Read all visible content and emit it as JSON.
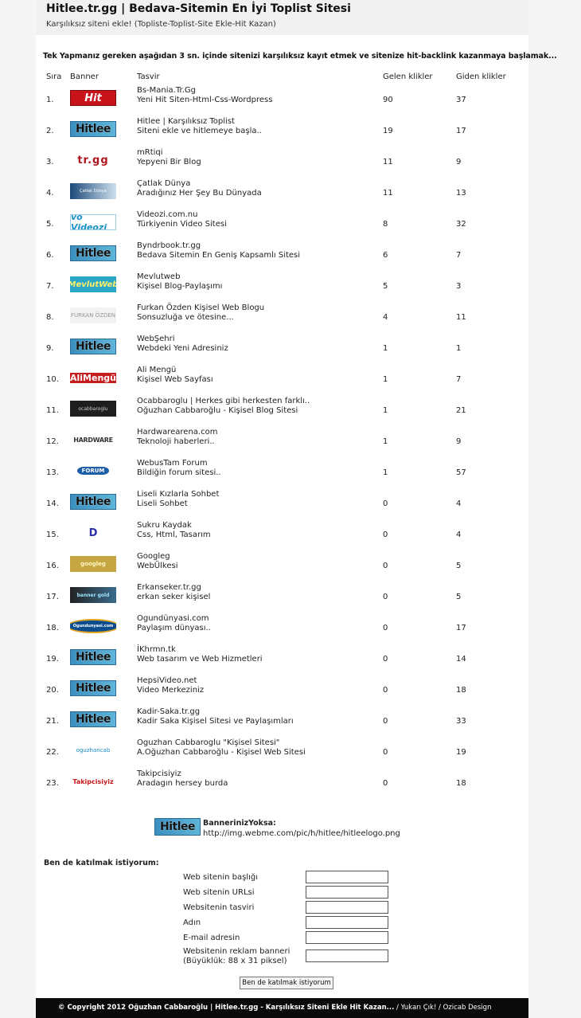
{
  "header": {
    "title": "Hitlee.tr.gg | Bedava-Sitemin En İyi Toplist Sitesi",
    "subtitle": "Karşılıksız siteni ekle! (Topliste-Toplist-Site Ekle-Hit Kazan)"
  },
  "intro": "Tek Yapmanız gereken aşağıdan 3 sn. içinde sitenizi karşılıksız kayıt etmek ve sitenize hit-backlink kazanmaya başlamak...",
  "table": {
    "columns": {
      "rank": "Sıra",
      "banner": "Banner",
      "desc": "Tasvir",
      "in": "Gelen klikler",
      "out": "Giden klikler"
    },
    "rows": [
      {
        "rank": "1.",
        "banner_text": "Hit",
        "banner_style": "b-hit",
        "title": "Bs-Mania.Tr.Gg",
        "desc": "Yeni Hit Siten-Html-Css-Wordpress",
        "in": "90",
        "out": "37"
      },
      {
        "rank": "2.",
        "banner_text": "Hitlee",
        "banner_style": "b-hitlee",
        "title": "Hitlee | Karşılıksız Toplist",
        "desc": "Siteni ekle ve hitlemeye başla..",
        "in": "19",
        "out": "17"
      },
      {
        "rank": "3.",
        "banner_text": "tr.gg",
        "banner_style": "b-trgg",
        "title": "mRtiqi",
        "desc": "Yepyeni Bir Blog",
        "in": "11",
        "out": "9"
      },
      {
        "rank": "4.",
        "banner_text": "Çatlak Dünya",
        "banner_style": "b-catlak",
        "title": "Çatlak Dünya",
        "desc": "Aradığınız Her Şey Bu Dünyada",
        "in": "11",
        "out": "13"
      },
      {
        "rank": "5.",
        "banner_text": "vo Videozi",
        "banner_style": "b-videozi",
        "title": "Videozi.com.nu",
        "desc": "Türkiyenin Video Sitesi",
        "in": "8",
        "out": "32"
      },
      {
        "rank": "6.",
        "banner_text": "Hitlee",
        "banner_style": "b-hitlee",
        "title": "Byndrbook.tr.gg",
        "desc": "Bedava Sitemin En Geniş Kapsamlı Sitesi",
        "in": "6",
        "out": "7"
      },
      {
        "rank": "7.",
        "banner_text": "MevlutWeb",
        "banner_style": "b-mevlut",
        "title": "Mevlutweb",
        "desc": "Kişisel Blog-Paylaşımı",
        "in": "5",
        "out": "3"
      },
      {
        "rank": "8.",
        "banner_text": "FURKAN ÖZDEN",
        "banner_style": "b-furkan",
        "title": "Furkan Özden Kişisel Web Blogu",
        "desc": "Sonsuzluğa ve ötesine...",
        "in": "4",
        "out": "11"
      },
      {
        "rank": "9.",
        "banner_text": "Hitlee",
        "banner_style": "b-hitlee",
        "title": "WebŞehri",
        "desc": "Webdeki Yeni Adresiniz",
        "in": "1",
        "out": "1"
      },
      {
        "rank": "10.",
        "banner_text": "AliMengü",
        "banner_style": "b-ali",
        "title": "Ali Mengü",
        "desc": "Kişisel Web Sayfası",
        "in": "1",
        "out": "7"
      },
      {
        "rank": "11.",
        "banner_text": "ocabbaroglu",
        "banner_style": "b-ocab",
        "title": "Ocabbaroglu | Herkes gibi herkesten farklı..",
        "desc": "Oğuzhan Cabbaroğlu - Kişisel Blog Sitesi",
        "in": "1",
        "out": "21"
      },
      {
        "rank": "12.",
        "banner_text": "HARDWARE",
        "banner_style": "b-hard",
        "title": "Hardwarearena.com",
        "desc": "Teknoloji haberleri..",
        "in": "1",
        "out": "9"
      },
      {
        "rank": "13.",
        "banner_text": "FORUM",
        "banner_style": "b-forum",
        "title": "WebusTam Forum",
        "desc": "Bildiğin forum sitesi..",
        "in": "1",
        "out": "57"
      },
      {
        "rank": "14.",
        "banner_text": "Hitlee",
        "banner_style": "b-hitlee",
        "title": "Liseli Kızlarla Sohbet",
        "desc": "Liseli Sohbet",
        "in": "0",
        "out": "4"
      },
      {
        "rank": "15.",
        "banner_text": "D",
        "banner_style": "b-sukru",
        "title": "Sukru Kaydak",
        "desc": "Css, Html, Tasarım",
        "in": "0",
        "out": "4"
      },
      {
        "rank": "16.",
        "banner_text": "googleg",
        "banner_style": "b-googleg",
        "title": "Googleg",
        "desc": "WebÜlkesi",
        "in": "0",
        "out": "5"
      },
      {
        "rank": "17.",
        "banner_text": "banner gold",
        "banner_style": "b-erkan",
        "title": "Erkanseker.tr.gg",
        "desc": "erkan seker kişisel",
        "in": "0",
        "out": "5"
      },
      {
        "rank": "18.",
        "banner_text": "Ogundunyasi.com",
        "banner_style": "b-ogun",
        "title": "Ogundünyasi.com",
        "desc": "Paylaşım dünyası..",
        "in": "0",
        "out": "17"
      },
      {
        "rank": "19.",
        "banner_text": "Hitlee",
        "banner_style": "b-hitlee",
        "title": "İKhrmn.tk",
        "desc": "Web tasarım ve Web Hizmetleri",
        "in": "0",
        "out": "14"
      },
      {
        "rank": "20.",
        "banner_text": "Hitlee",
        "banner_style": "b-hitlee",
        "title": "HepsiVideo.net",
        "desc": "Video Merkeziniz",
        "in": "0",
        "out": "18"
      },
      {
        "rank": "21.",
        "banner_text": "Hitlee",
        "banner_style": "b-hitlee",
        "title": "Kadir-Saka.tr.gg",
        "desc": "Kadir Saka Kişisel Sitesi ve Paylaşımları",
        "in": "0",
        "out": "33"
      },
      {
        "rank": "22.",
        "banner_text": "oguzhancab",
        "banner_style": "b-oguzhan",
        "title": "Oguzhan Cabbaroglu \"Kişisel Sitesi\"",
        "desc": "A.Oğuzhan Cabbaroğlu - Kişisel Web Sitesi",
        "in": "0",
        "out": "19"
      },
      {
        "rank": "23.",
        "banner_text": "Takipcisiyiz",
        "banner_style": "b-takip",
        "title": "Takipcisiyiz",
        "desc": "Aradagın hersey burda",
        "in": "0",
        "out": "18"
      }
    ]
  },
  "ad": {
    "banner_text": "Hitlee",
    "label": "BannerinizYoksa:",
    "url": "http://img.webme.com/pic/h/hitlee/hitleelogo.png"
  },
  "join": {
    "heading": "Ben de katılmak istiyorum:",
    "fields": [
      {
        "label": "Web sitenin başlığı",
        "value": ""
      },
      {
        "label": "Web sitenin URLsi",
        "value": ""
      },
      {
        "label": "Websitenin tasviri",
        "value": ""
      },
      {
        "label": "Adın",
        "value": ""
      },
      {
        "label": "E-mail adresin",
        "value": ""
      },
      {
        "label_line1": "Websitenin reklam banneri",
        "label_line2": "(Büyüklük: 88 x 31 piksel)",
        "value": ""
      }
    ],
    "submit_label": "Ben de katılmak istiyorum"
  },
  "footer": {
    "copyright": "© Copyright 2012 Oğuzhan Cabbaroğlu | Hitlee.tr.gg - Karşılıksız Siteni Ekle Hit Kazan...",
    "links": " / Yukarı Çık! / Ozicab Design"
  },
  "colors": {
    "page_bg": "#f5f5f5",
    "content_bg": "#ffffff",
    "header_bg": "#f1f1f1",
    "footer_bg": "#0a0a0a"
  }
}
